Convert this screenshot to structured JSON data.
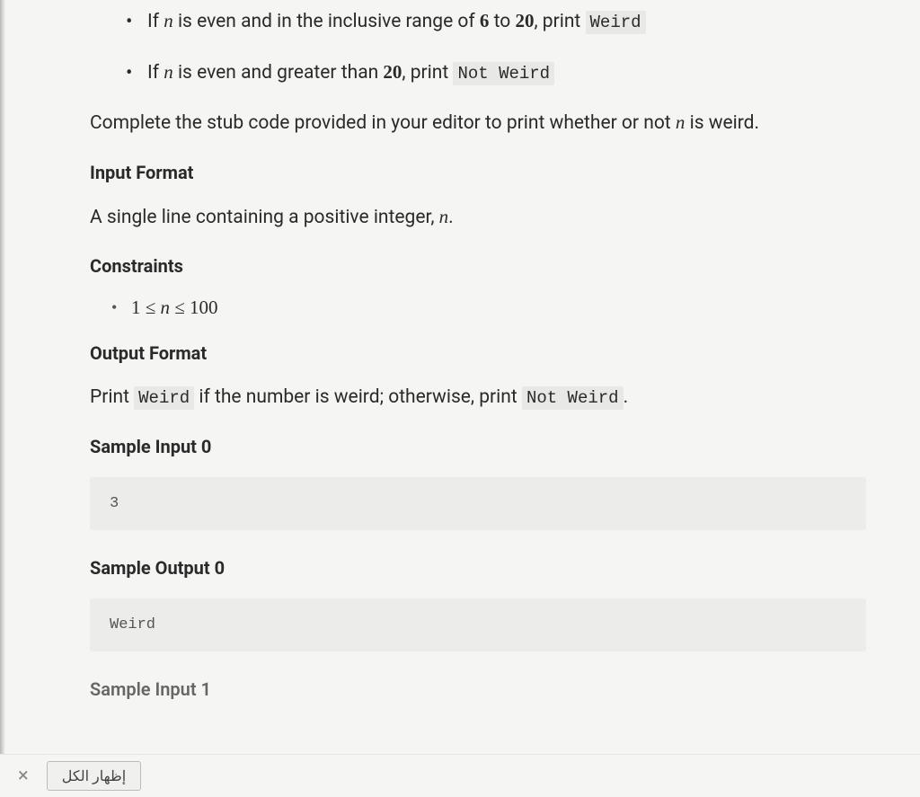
{
  "bullets": [
    {
      "prefix": "If ",
      "var": "n",
      "mid1": " is even and in the inclusive range of ",
      "num1": "6",
      "mid2": " to ",
      "num2": "20",
      "mid3": ", print ",
      "code": "Weird"
    },
    {
      "prefix": "If ",
      "var": "n",
      "mid1": " is even and greater than ",
      "num1": "20",
      "mid3": ", print ",
      "code": "Not Weird"
    }
  ],
  "instruction": {
    "t1": "Complete the stub code provided in your editor to print whether or not ",
    "var": "n",
    "t2": " is weird."
  },
  "headings": {
    "input_format": "Input Format",
    "constraints": "Constraints",
    "output_format": "Output Format",
    "sample_input_0": "Sample Input 0",
    "sample_output_0": "Sample Output 0",
    "sample_input_1": "Sample Input 1"
  },
  "input_desc": {
    "t1": "A single line containing a positive integer, ",
    "var": "n",
    "t2": "."
  },
  "constraint": "1 ≤ n ≤ 100",
  "output_desc": {
    "t1": "Print ",
    "code1": "Weird",
    "t2": " if the number is weird; otherwise, print ",
    "code2": "Not Weird",
    "t3": "."
  },
  "samples": {
    "input0": "3",
    "output0": "Weird"
  },
  "bottom": {
    "close": "×",
    "show_all": "إظهار الكل"
  }
}
